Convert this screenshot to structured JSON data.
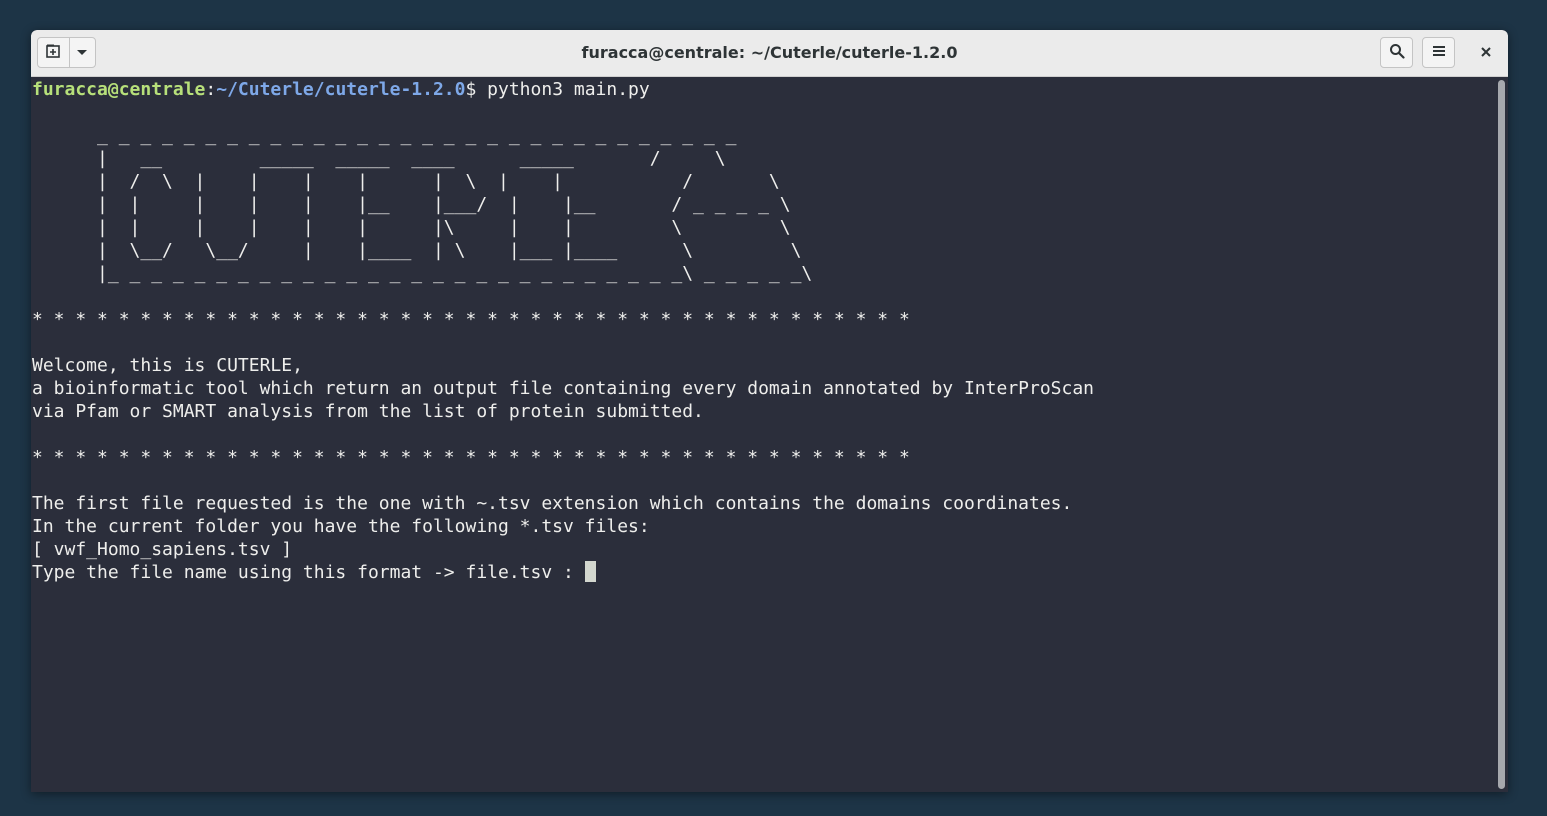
{
  "window": {
    "title": "furacca@centrale: ~/Cuterle/cuterle-1.2.0"
  },
  "header_buttons": {
    "new_tab_icon": "new-tab-icon",
    "tab_menu_icon": "chevron-down-icon",
    "search_icon": "search-icon",
    "menu_icon": "hamburger-menu-icon",
    "close_icon": "close-icon"
  },
  "terminal": {
    "prompt_user": "furacca@centrale",
    "prompt_sep": ":",
    "prompt_path": "~/Cuterle/cuterle-1.2.0",
    "prompt_symbol": "$ ",
    "command": "python3 main.py",
    "banner": "\n      _ _ _ _ _ _ _ _ _ _ _ _ _ _ _ _ _ _ _ _ _ _ _ _ _ _ _ _ _ _\n      |   __         _____  _____  ____      _____       /     \\\n      |  /  \\  |    |    |    |      |  \\  |    |           /       \\\n      |  |     |    |    |    |__    |___/  |    |__       / _ _ _ _ \\\n      |  |     |    |    |    |      |\\     |    |         \\         \\\n      |  \\__/   \\__/     |    |____  | \\    |___ |____      \\         \\\n      |_ _ _ _ _ _ _ _ _ _ _ _ _ _ _ _ _ _ _ _ _ _ _ _ _ _ _\\ _ _ _ _ _\\\n",
    "separator": "* * * * * * * * * * * * * * * * * * * * * * * * * * * * * * * * * * * * * * * * *",
    "welcome_lines": "Welcome, this is CUTERLE,\na bioinformatic tool which return an output file containing every domain annotated by InterProScan\nvia Pfam or SMART analysis from the list of protein submitted.",
    "request_lines": "The first file requested is the one with ~.tsv extension which contains the domains coordinates.\nIn the current folder you have the following *.tsv files:\n[ vwf_Homo_sapiens.tsv ]",
    "input_prompt": "Type the file name using this format -> file.tsv : "
  },
  "colors": {
    "terminal_bg": "#2b2e3b",
    "prompt_user": "#b7e07a",
    "prompt_path": "#7ea8e8",
    "text": "#eeeeec",
    "desktop_bg": "#1d3446"
  }
}
